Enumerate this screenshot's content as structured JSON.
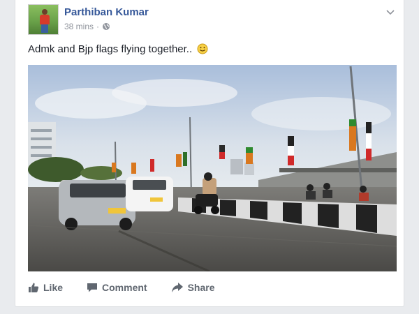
{
  "post": {
    "author": "Parthiban Kumar",
    "time": "38 mins",
    "separator": "·",
    "privacy_icon": "globe-icon",
    "text": "Admk and Bjp flags flying together..",
    "emoji": "smiley-face",
    "photo_description_icon": "photo"
  },
  "actions": {
    "like": "Like",
    "comment": "Comment",
    "share": "Share"
  },
  "colors": {
    "author_link": "#365899",
    "meta": "#90949c",
    "action": "#606770",
    "background": "#e9ebee"
  }
}
